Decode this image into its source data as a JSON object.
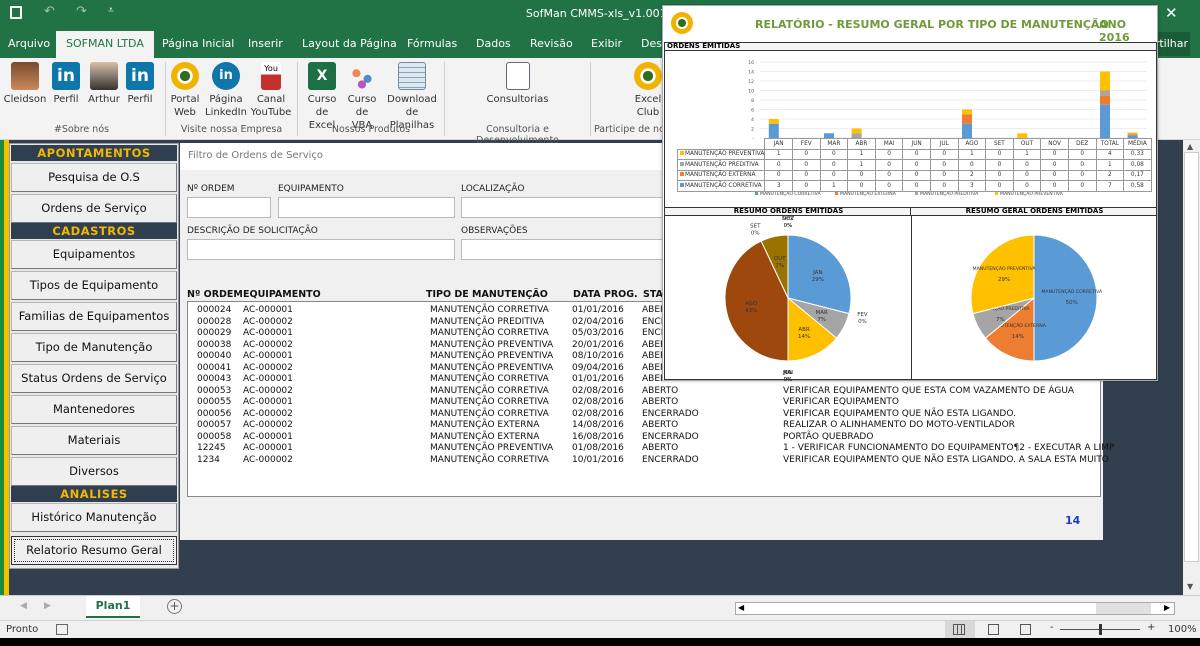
{
  "window": {
    "title": "SofMan CMMS-xls_v1.001 -",
    "close_icon": "close-icon"
  },
  "tabs": [
    "Arquivo",
    "SOFMAN LTDA",
    "Página Inicial",
    "Inserir",
    "Layout da Página",
    "Fórmulas",
    "Dados",
    "Revisão",
    "Exibir",
    "Desenvolvedor"
  ],
  "share_label": "Compartilhar",
  "ribbon": {
    "items": [
      {
        "label": "Cleidson",
        "icon": "profile-photo"
      },
      {
        "label": "Perfil",
        "icon": "linkedin-icon"
      },
      {
        "label": "Arthur",
        "icon": "profile-photo"
      },
      {
        "label": "Perfil",
        "icon": "linkedin-icon"
      },
      {
        "label": "Portal Web",
        "icon": "sofman-logo-icon"
      },
      {
        "label": "Página LinkedIn",
        "icon": "linkedin-icon"
      },
      {
        "label": "Canal YouTube",
        "icon": "youtube-icon"
      },
      {
        "label": "Curso de Excel",
        "icon": "excel-icon"
      },
      {
        "label": "Curso de VBA",
        "icon": "vba-icon"
      },
      {
        "label": "Download de Planilhas",
        "icon": "spreadsheet-icon"
      },
      {
        "label": "Consultorias",
        "icon": "consulting-icon"
      },
      {
        "label": "Excel Club",
        "icon": "sofman-logo-icon"
      }
    ],
    "groups": [
      "#Sobre nós",
      "Visite nossa Empresa",
      "Nossos Produtos",
      "Consultoria e Desenvolvimento",
      "Participe de no"
    ]
  },
  "sidebar": {
    "sections": [
      "APONTAMENTOS",
      "CADASTROS",
      "ANALISES"
    ],
    "buttons": [
      "Pesquisa de O.S",
      "Ordens de Serviço",
      "Equipamentos",
      "Tipos de Equipamento",
      "Familias de Equipamentos",
      "Tipo de Manutenção",
      "Status Ordens de Serviço",
      "Mantenedores",
      "Materiais",
      "Diversos",
      "Histórico Manutenção",
      "Relatorio Resumo Geral"
    ],
    "selected": "Relatorio Resumo Geral"
  },
  "filter": {
    "title": "Filtro de Ordens de Serviço",
    "labels": {
      "ordem": "Nº ORDEM",
      "equipamento": "EQUIPAMENTO",
      "localizacao": "LOCALIZAÇÃO",
      "descricao": "DESCRIÇÃO DE SOLICITAÇÃO",
      "observacoes": "OBSERVAÇÕES"
    },
    "values": {
      "ordem": "",
      "equipamento": "",
      "localizacao": "",
      "descricao": "",
      "observacoes": ""
    }
  },
  "orders": {
    "columns": [
      "Nº ORDEM",
      "EQUIPAMENTO",
      "TIPO DE MANUTENÇÃO",
      "DATA PROG.",
      "STATUS"
    ],
    "rows": [
      [
        "000024",
        "AC-000001",
        "MANUTENÇÃO CORRETIVA",
        "01/01/2016",
        "ABERTO",
        ""
      ],
      [
        "000028",
        "AC-000002",
        "MANUTENÇÃO PREDITIVA",
        "02/04/2016",
        "ENCERRADO",
        ""
      ],
      [
        "000029",
        "AC-000001",
        "MANUTENÇÃO CORRETIVA",
        "05/03/2016",
        "ENCERRADO",
        ""
      ],
      [
        "000038",
        "AC-000002",
        "MANUTENÇÃO PREVENTIVA",
        "20/01/2016",
        "ABERTO",
        ""
      ],
      [
        "000040",
        "AC-000001",
        "MANUTENÇÃO PREVENTIVA",
        "08/10/2016",
        "ABERTO",
        ""
      ],
      [
        "000041",
        "AC-000002",
        "MANUTENÇÃO PREVENTIVA",
        "09/04/2016",
        "ABERTO",
        ""
      ],
      [
        "000043",
        "AC-000001",
        "MANUTENÇÃO CORRETIVA",
        "01/01/2016",
        "ABERTO",
        ""
      ],
      [
        "000053",
        "AC-000002",
        "MANUTENÇÃO CORRETIVA",
        "02/08/2016",
        "ABERTO",
        "VERIFICAR EQUIPAMENTO QUE ESTA COM VAZAMENTO DE ÁGUA"
      ],
      [
        "000055",
        "AC-000001",
        "MANUTENÇÃO CORRETIVA",
        "02/08/2016",
        "ABERTO",
        "VERIFICAR EQUIPAMENTO"
      ],
      [
        "000056",
        "AC-000002",
        "MANUTENÇÃO CORRETIVA",
        "02/08/2016",
        "ENCERRADO",
        "VERIFICAR EQUIPAMENTO QUE NÃO ESTA LIGANDO."
      ],
      [
        "000057",
        "AC-000002",
        "MANUTENÇÃO EXTERNA",
        "14/08/2016",
        "ABERTO",
        "REALIZAR O ALINHAMENTO DO MOTO-VENTILADOR"
      ],
      [
        "000058",
        "AC-000001",
        "MANUTENÇÃO EXTERNA",
        "16/08/2016",
        "ENCERRADO",
        "PORTÃO QUEBRADO"
      ],
      [
        "12245",
        "AC-000001",
        "MANUTENÇÃO PREVENTIVA",
        "01/08/2016",
        "ABERTO",
        "1 - VERIFICAR FUNCIONAMENTO DO EQUIPAMENTO¶2 - EXECUTAR A LIMP"
      ],
      [
        "1234",
        "AC-000002",
        "MANUTENÇÃO CORRETIVA",
        "10/01/2016",
        "ENCERRADO",
        "VERIFICAR EQUIPAMENTO QUE NÃO ESTA LIGANDO. A SALA ESTA MUITO"
      ]
    ],
    "page_number": "14"
  },
  "report": {
    "title": "RELATÓRIO - RESUMO GERAL POR TIPO DE MANUTENÇÃO",
    "year": "ANO 2016",
    "section_orders": "ORDENS EMITIDAS",
    "section_pie1": "RESUMO ORDENS EMITIDAS",
    "section_pie2": "RESUMO GERAL ORDENS EMITIDAS"
  },
  "chart_data": [
    {
      "type": "bar",
      "stacked": true,
      "categories": [
        "JAN",
        "FEV",
        "MAR",
        "ABR",
        "MAI",
        "JUN",
        "JUL",
        "AGO",
        "SET",
        "OUT",
        "NOV",
        "DEZ",
        "TOTAL",
        "MÉDIA"
      ],
      "yticks": [
        "-",
        "2",
        "4",
        "6",
        "8",
        "10",
        "12",
        "14",
        "16"
      ],
      "ylim": [
        0,
        16
      ],
      "grid": true,
      "legend": "bottom",
      "series": [
        {
          "name": "MANUTENÇÃO CORRETIVA",
          "color": "#5b9bd5",
          "values": [
            3,
            0,
            1,
            0,
            0,
            0,
            0,
            3,
            0,
            0,
            0,
            0,
            7,
            0.58
          ],
          "labels": [
            "3",
            "0",
            "1",
            "0",
            "0",
            "0",
            "0",
            "3",
            "0",
            "0",
            "0",
            "0",
            "7",
            "0,58"
          ]
        },
        {
          "name": "MANUTENÇÃO EXTERNA",
          "color": "#ed7d31",
          "values": [
            0,
            0,
            0,
            0,
            0,
            0,
            0,
            2,
            0,
            0,
            0,
            0,
            2,
            0.17
          ],
          "labels": [
            "0",
            "0",
            "0",
            "0",
            "0",
            "0",
            "0",
            "2",
            "0",
            "0",
            "0",
            "0",
            "2",
            "0,17"
          ]
        },
        {
          "name": "MANUTENÇÃO PREDITIVA",
          "color": "#a5a5a5",
          "values": [
            0,
            0,
            0,
            1,
            0,
            0,
            0,
            0,
            0,
            0,
            0,
            0,
            1,
            0.08
          ],
          "labels": [
            "0",
            "0",
            "0",
            "1",
            "0",
            "0",
            "0",
            "0",
            "0",
            "0",
            "0",
            "0",
            "1",
            "0,08"
          ]
        },
        {
          "name": "MANUTENÇÃO PREVENTIVA",
          "color": "#ffc000",
          "values": [
            1,
            0,
            0,
            1,
            0,
            0,
            0,
            1,
            0,
            1,
            0,
            0,
            4,
            0.33
          ],
          "labels": [
            "1",
            "0",
            "0",
            "1",
            "0",
            "0",
            "0",
            "1",
            "0",
            "1",
            "0",
            "0",
            "4",
            "0,33"
          ]
        }
      ]
    },
    {
      "type": "pie",
      "slices": [
        {
          "label": "JAN",
          "value": 29,
          "text": "29%",
          "color": "#5b9bd5"
        },
        {
          "label": "FEV",
          "value": 0,
          "text": "0%",
          "color": "#ed7d31"
        },
        {
          "label": "MAR",
          "value": 7,
          "text": "7%",
          "color": "#a5a5a5"
        },
        {
          "label": "ABR",
          "value": 14,
          "text": "14%",
          "color": "#ffc000"
        },
        {
          "label": "MAI",
          "value": 0,
          "text": "0%",
          "color": "#4472c4"
        },
        {
          "label": "JUN",
          "value": 0,
          "text": "0%",
          "color": "#70ad47"
        },
        {
          "label": "JUL",
          "value": 0,
          "text": "0%",
          "color": "#264478"
        },
        {
          "label": "AGO",
          "value": 43,
          "text": "43%",
          "color": "#9e480e"
        },
        {
          "label": "SET",
          "value": 0,
          "text": "0%",
          "color": "#636363"
        },
        {
          "label": "OUT",
          "value": 7,
          "text": "7%",
          "color": "#997300"
        },
        {
          "label": "NOV",
          "value": 0,
          "text": "0%",
          "color": "#255e91"
        },
        {
          "label": "DEZ",
          "value": 0,
          "text": "0%",
          "color": "#43682b"
        }
      ]
    },
    {
      "type": "pie",
      "slices": [
        {
          "label": "MANUTENÇÃO CORRETIVA",
          "value": 50,
          "text": "50%",
          "color": "#5b9bd5"
        },
        {
          "label": "MANUTENÇÃO EXTERNA",
          "value": 14,
          "text": "14%",
          "color": "#ed7d31"
        },
        {
          "label": "MANUTENÇÃO PREDITIVA",
          "value": 7,
          "text": "7%",
          "color": "#a5a5a5"
        },
        {
          "label": "MANUTENÇÃO PREVENTIVA",
          "value": 29,
          "text": "29%",
          "color": "#ffc000"
        }
      ]
    }
  ],
  "sheet": {
    "tabs": [
      "Plan1"
    ],
    "add_icon": "plus-icon"
  },
  "status": {
    "ready": "Pronto",
    "zoom": "100%"
  },
  "colors": {
    "excel_green": "#217346",
    "sidebar_header": "#2f3f50",
    "sidebar_header_text": "#f2b800",
    "report_title": "#6f9a3a"
  }
}
